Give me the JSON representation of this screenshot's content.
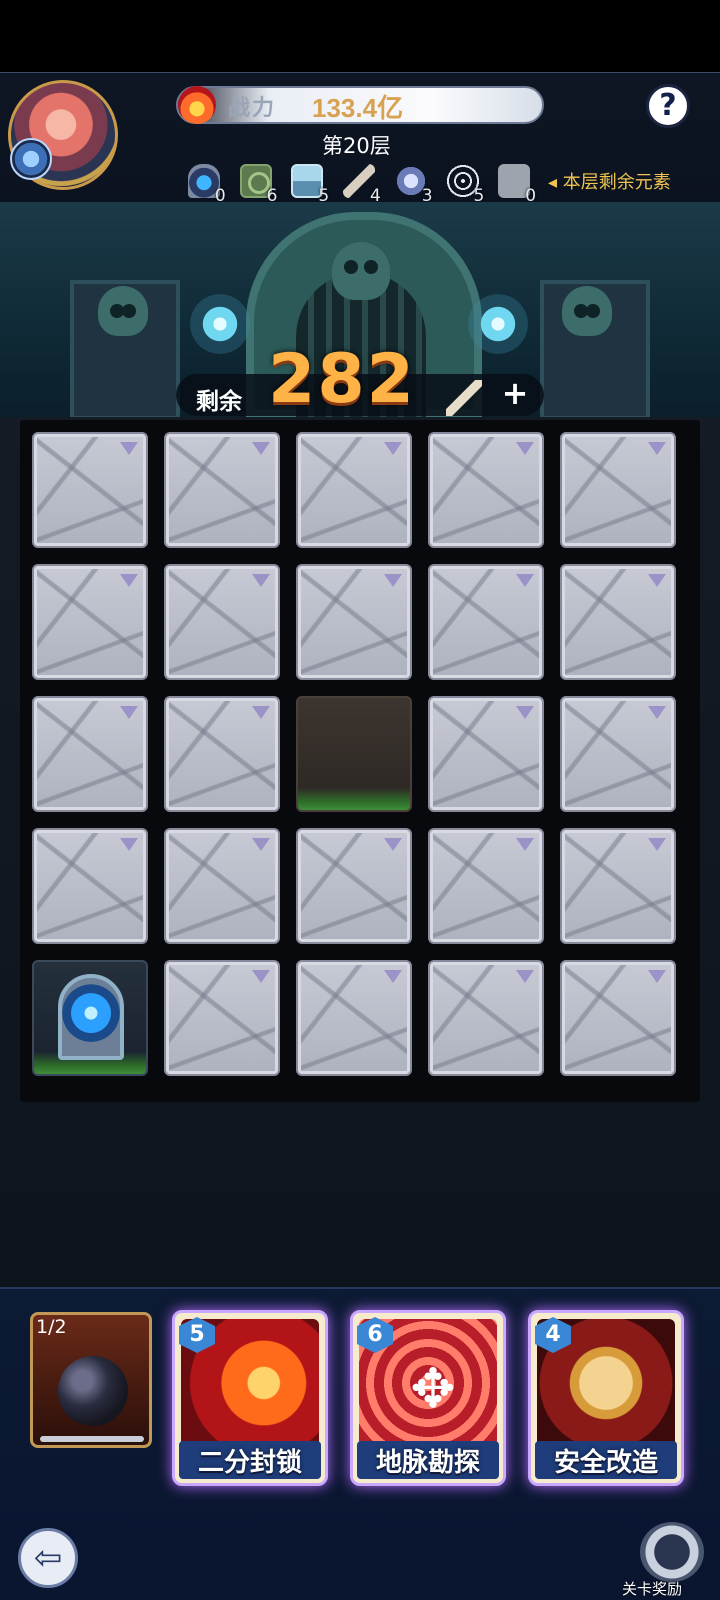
{
  "header": {
    "power_label": "战力",
    "power_value": "133.4亿",
    "floor_label": "第20层",
    "help_label": "?"
  },
  "elements": [
    {
      "icon": "portal-icon",
      "count": "0"
    },
    {
      "icon": "blocked-icon",
      "count": "6"
    },
    {
      "icon": "treasure-chest-icon",
      "count": "5"
    },
    {
      "icon": "pickaxe-icon",
      "count": "4"
    },
    {
      "icon": "crossed-swords-icon",
      "count": "3"
    },
    {
      "icon": "spider-web-icon",
      "count": "5"
    },
    {
      "icon": "puzzle-piece-icon",
      "count": "0"
    }
  ],
  "remaining_elements_label": "◂ 本层剩余元素",
  "dig": {
    "remaining_label": "剩余",
    "remaining_value": "282",
    "add_label": "+"
  },
  "grid": {
    "rows": 5,
    "cols": 5,
    "open_tiles": [
      "r3c3"
    ],
    "portal_tile": "r5c1"
  },
  "items": {
    "bomb_count": "1/2"
  },
  "skills": [
    {
      "cost": "5",
      "name": "二分封锁",
      "icon": "chain-icon"
    },
    {
      "cost": "6",
      "name": "地脉勘探",
      "icon": "vortex-arrows-icon"
    },
    {
      "cost": "4",
      "name": "安全改造",
      "icon": "shield-icon"
    }
  ],
  "footer": {
    "exit_icon": "exit-icon",
    "reward_label": "关卡奖励"
  }
}
